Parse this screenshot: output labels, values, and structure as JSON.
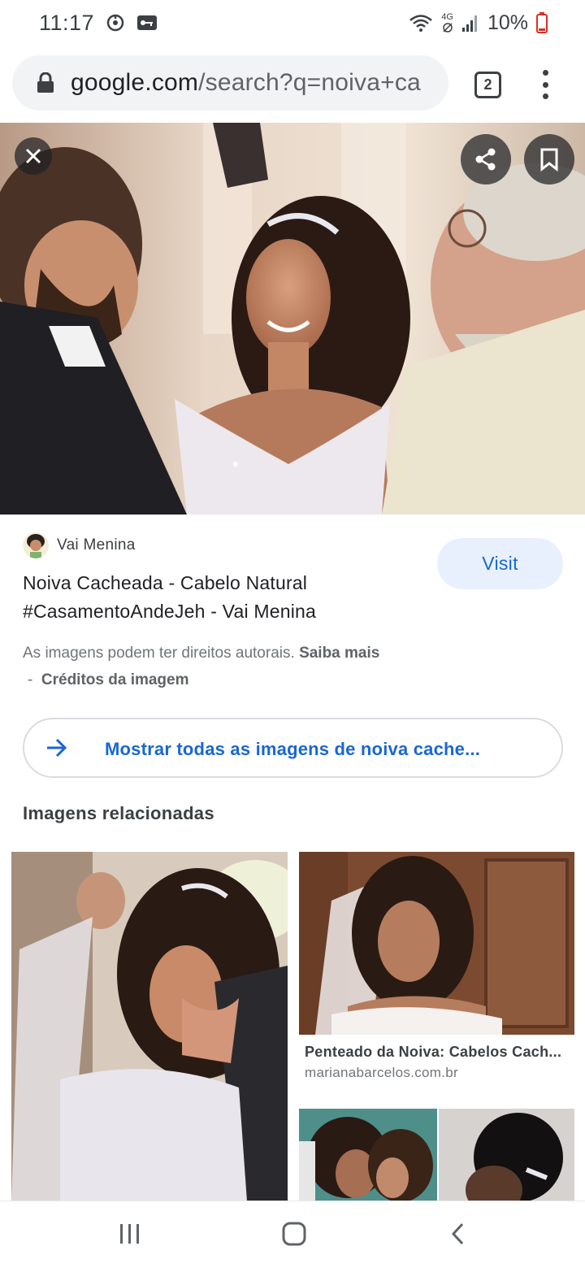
{
  "status_bar": {
    "time": "11:17",
    "network": "4G",
    "battery": "10%"
  },
  "browser": {
    "url_domain": "google.com",
    "url_path": "/search?q=noiva+ca",
    "tab_count": "2"
  },
  "hero": {
    "close_icon": "close-icon",
    "share_icon": "share-icon",
    "bookmark_icon": "bookmark-icon"
  },
  "result": {
    "source_name": "Vai Menina",
    "title": "Noiva Cacheada - Cabelo Natural #CasamentoAndeJeh - Vai Menina",
    "visit_label": "Visit",
    "copyright_text": "As imagens podem ter direitos autorais.",
    "learn_more": "Saiba mais",
    "credits_separator": "-",
    "credits": "Créditos da imagem",
    "show_all_label": "Mostrar todas as imagens de noiva cache..."
  },
  "related": {
    "heading": "Imagens relacionadas",
    "items": [
      {
        "caption": "Penteado da Noiva: Cabelos Cach...",
        "domain": "marianabarcelos.com.br"
      }
    ]
  },
  "colors": {
    "link_blue": "#1967d2",
    "visit_bg": "#e8f0fe",
    "url_bar_bg": "#f1f3f4"
  }
}
